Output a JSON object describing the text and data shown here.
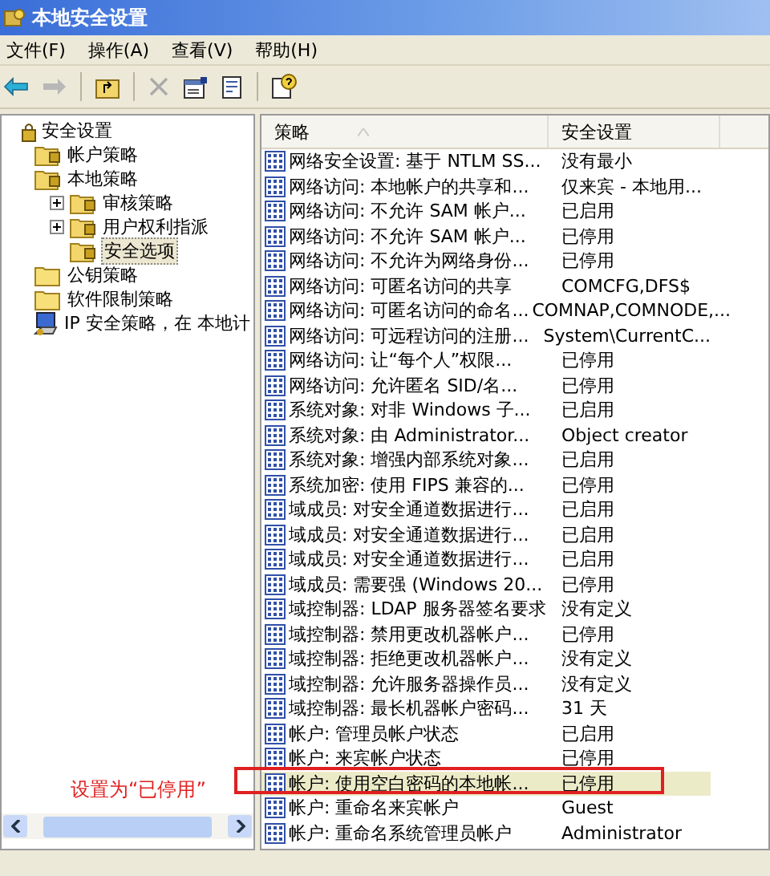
{
  "window": {
    "title": "本地安全设置"
  },
  "menu": [
    "文件(F)",
    "操作(A)",
    "查看(V)",
    "帮助(H)"
  ],
  "tree": [
    {
      "label": "安全设置",
      "kind": "root",
      "selected": false,
      "collapsed": false,
      "children": [
        {
          "label": "帐户策略",
          "kind": "folder-lock",
          "selected": false,
          "collapsed": false
        },
        {
          "label": "本地策略",
          "kind": "folder-lock",
          "selected": false,
          "collapsed": false,
          "children": [
            {
              "label": "审核策略",
              "kind": "folder-lock",
              "selected": false,
              "collapsed": true
            },
            {
              "label": "用户权利指派",
              "kind": "folder-lock",
              "selected": false,
              "collapsed": true
            },
            {
              "label": "安全选项",
              "kind": "folder-lock",
              "selected": true,
              "collapsed": false
            }
          ]
        },
        {
          "label": "公钥策略",
          "kind": "folder",
          "selected": false,
          "collapsed": false
        },
        {
          "label": "软件限制策略",
          "kind": "folder",
          "selected": false,
          "collapsed": false
        },
        {
          "label": "IP 安全策略，在 本地计",
          "kind": "ip",
          "selected": false,
          "collapsed": false
        }
      ]
    }
  ],
  "table": {
    "columns": [
      "策略",
      "安全设置"
    ],
    "rows": [
      {
        "policy": "网络安全设置: 基于 NTLM SS...",
        "setting": "没有最小",
        "selected": false
      },
      {
        "policy": "网络访问: 本地帐户的共享和...",
        "setting": "仅来宾 - 本地用...",
        "selected": false
      },
      {
        "policy": "网络访问: 不允许 SAM 帐户...",
        "setting": "已启用",
        "selected": false
      },
      {
        "policy": "网络访问: 不允许 SAM 帐户...",
        "setting": "已停用",
        "selected": false
      },
      {
        "policy": "网络访问: 不允许为网络身份...",
        "setting": "已停用",
        "selected": false
      },
      {
        "policy": "网络访问: 可匿名访问的共享",
        "setting": "COMCFG,DFS$",
        "selected": false
      },
      {
        "policy": "网络访问: 可匿名访问的命名...",
        "setting": "COMNAP,COMNODE,...",
        "selected": false
      },
      {
        "policy": "网络访问: 可远程访问的注册...",
        "setting": "System\\CurrentC...",
        "selected": false
      },
      {
        "policy": "网络访问: 让“每个人”权限...",
        "setting": "已停用",
        "selected": false
      },
      {
        "policy": "网络访问: 允许匿名 SID/名...",
        "setting": "已停用",
        "selected": false
      },
      {
        "policy": "系统对象: 对非 Windows 子...",
        "setting": "已启用",
        "selected": false
      },
      {
        "policy": "系统对象: 由 Administrator...",
        "setting": "Object creator",
        "selected": false
      },
      {
        "policy": "系统对象: 增强内部系统对象...",
        "setting": "已启用",
        "selected": false
      },
      {
        "policy": "系统加密: 使用 FIPS 兼容的...",
        "setting": "已停用",
        "selected": false
      },
      {
        "policy": "域成员: 对安全通道数据进行...",
        "setting": "已启用",
        "selected": false
      },
      {
        "policy": "域成员: 对安全通道数据进行...",
        "setting": "已启用",
        "selected": false
      },
      {
        "policy": "域成员: 对安全通道数据进行...",
        "setting": "已启用",
        "selected": false
      },
      {
        "policy": "域成员: 需要强 (Windows 20...",
        "setting": "已停用",
        "selected": false
      },
      {
        "policy": "域控制器: LDAP 服务器签名要求",
        "setting": "没有定义",
        "selected": false
      },
      {
        "policy": "域控制器: 禁用更改机器帐户...",
        "setting": "已停用",
        "selected": false
      },
      {
        "policy": "域控制器: 拒绝更改机器帐户...",
        "setting": "没有定义",
        "selected": false
      },
      {
        "policy": "域控制器: 允许服务器操作员...",
        "setting": "没有定义",
        "selected": false
      },
      {
        "policy": "域控制器: 最长机器帐户密码...",
        "setting": "31 天",
        "selected": false
      },
      {
        "policy": "帐户: 管理员帐户状态",
        "setting": "已启用",
        "selected": false
      },
      {
        "policy": "帐户: 来宾帐户状态",
        "setting": "已停用",
        "selected": false
      },
      {
        "policy": "帐户: 使用空白密码的本地帐...",
        "setting": "已停用",
        "selected": true
      },
      {
        "policy": "帐户: 重命名来宾帐户",
        "setting": "Guest",
        "selected": false
      },
      {
        "policy": "帐户: 重命名系统管理员帐户",
        "setting": "Administrator",
        "selected": false
      }
    ]
  },
  "annotation": {
    "text": "设置为“已停用”"
  }
}
